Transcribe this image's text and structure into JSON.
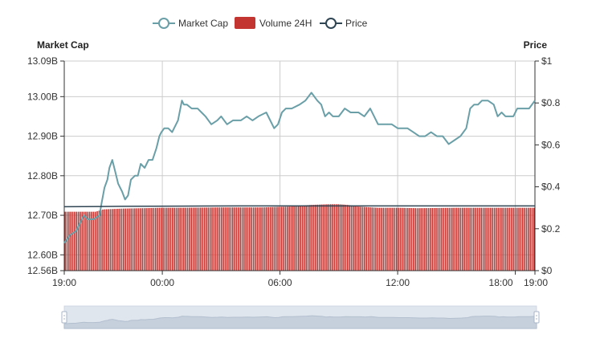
{
  "colors": {
    "market_cap": "#6a9fa8",
    "volume": "#c23531",
    "price": "#2f4554",
    "grid": "#cccccc",
    "zoom_fill": "#c7d0dd"
  },
  "legend": {
    "items": [
      {
        "name": "Market Cap",
        "icon": "line-circle-icon"
      },
      {
        "name": "Volume 24H",
        "icon": "rect-icon"
      },
      {
        "name": "Price",
        "icon": "line-circle-icon"
      }
    ]
  },
  "chart_data": {
    "type": "line",
    "title": "",
    "left_axis": {
      "title": "Market Cap",
      "min": 12.56,
      "max": 13.09,
      "unit": "B",
      "ticks": [
        "13.09B",
        "13.00B",
        "12.90B",
        "12.80B",
        "12.70B",
        "12.60B",
        "12.56B"
      ],
      "tick_values": [
        13.09,
        13.0,
        12.9,
        12.8,
        12.7,
        12.6,
        12.56
      ]
    },
    "right_axis": {
      "title": "Price",
      "min": 0,
      "max": 1,
      "ticks": [
        "$1",
        "$0.8",
        "$0.6",
        "$0.4",
        "$0.2",
        "$0"
      ],
      "tick_values": [
        1,
        0.8,
        0.6,
        0.4,
        0.2,
        0
      ]
    },
    "x_axis": {
      "min": 0,
      "max": 24,
      "ticks": [
        "19:00",
        "00:00",
        "06:00",
        "12:00",
        "18:00",
        "19:00"
      ],
      "tick_values": [
        0,
        5,
        11,
        17,
        23,
        24
      ]
    },
    "grid": true,
    "legend_position": "top-center",
    "series": [
      {
        "name": "Market Cap",
        "axis": "left",
        "x": [
          0,
          0.3,
          0.6,
          0.8,
          1.0,
          1.2,
          1.5,
          1.8,
          1.9,
          2.05,
          2.2,
          2.3,
          2.45,
          2.6,
          2.75,
          2.95,
          3.1,
          3.25,
          3.4,
          3.6,
          3.75,
          3.9,
          4.1,
          4.3,
          4.5,
          4.7,
          4.85,
          4.95,
          5.1,
          5.3,
          5.5,
          5.8,
          6.0,
          6.1,
          6.25,
          6.5,
          6.8,
          7.0,
          7.2,
          7.5,
          7.8,
          8.0,
          8.3,
          8.6,
          9.0,
          9.3,
          9.6,
          9.9,
          10.3,
          10.7,
          10.9,
          11.1,
          11.3,
          11.6,
          12.0,
          12.3,
          12.6,
          12.9,
          13.1,
          13.3,
          13.5,
          13.7,
          14.0,
          14.3,
          14.6,
          15.0,
          15.3,
          15.6,
          16.0,
          16.3,
          16.7,
          17.0,
          17.3,
          17.5,
          17.8,
          18.1,
          18.4,
          18.7,
          19.0,
          19.3,
          19.6,
          19.9,
          20.2,
          20.5,
          20.7,
          20.9,
          21.1,
          21.3,
          21.6,
          21.9,
          22.1,
          22.3,
          22.5,
          22.7,
          22.9,
          23.1,
          23.3,
          23.5,
          23.7,
          24.0
        ],
        "values": [
          12.63,
          12.65,
          12.66,
          12.68,
          12.7,
          12.69,
          12.69,
          12.7,
          12.73,
          12.77,
          12.79,
          12.82,
          12.84,
          12.81,
          12.78,
          12.76,
          12.74,
          12.75,
          12.79,
          12.8,
          12.8,
          12.83,
          12.82,
          12.84,
          12.84,
          12.87,
          12.9,
          12.91,
          12.92,
          12.92,
          12.91,
          12.94,
          12.99,
          12.98,
          12.98,
          12.97,
          12.97,
          12.96,
          12.95,
          12.93,
          12.94,
          12.95,
          12.93,
          12.94,
          12.94,
          12.95,
          12.94,
          12.95,
          12.96,
          12.92,
          12.93,
          12.96,
          12.97,
          12.97,
          12.98,
          12.99,
          13.01,
          12.99,
          12.98,
          12.95,
          12.96,
          12.95,
          12.95,
          12.97,
          12.96,
          12.96,
          12.95,
          12.97,
          12.93,
          12.93,
          12.93,
          12.92,
          12.92,
          12.92,
          12.91,
          12.9,
          12.9,
          12.91,
          12.9,
          12.9,
          12.88,
          12.89,
          12.9,
          12.92,
          12.97,
          12.98,
          12.98,
          12.99,
          12.99,
          12.98,
          12.95,
          12.96,
          12.95,
          12.95,
          12.95,
          12.97,
          12.97,
          12.97,
          12.97,
          12.99
        ]
      },
      {
        "name": "Volume 24H",
        "axis": "left",
        "type": "bar",
        "x_start": 0,
        "x_end": 24,
        "envelope_x": [
          0,
          1.6,
          2.0,
          3.0,
          5.0,
          6.0,
          8.0,
          10.0,
          11.5,
          12.5,
          13.5,
          14.0,
          14.5,
          15.0,
          16.0,
          17.0,
          18.0,
          20.0,
          22.0,
          24.0
        ],
        "envelope_values": [
          12.709,
          12.709,
          12.715,
          12.717,
          12.719,
          12.719,
          12.72,
          12.72,
          12.722,
          12.726,
          12.728,
          12.728,
          12.726,
          12.722,
          12.719,
          12.719,
          12.718,
          12.719,
          12.719,
          12.719
        ]
      },
      {
        "name": "Price",
        "axis": "right",
        "x": [
          0,
          3,
          6,
          9,
          12,
          15,
          18,
          21,
          24
        ],
        "values": [
          0.305,
          0.307,
          0.308,
          0.309,
          0.309,
          0.309,
          0.309,
          0.309,
          0.309
        ]
      }
    ],
    "data_zoom": {
      "start": 0,
      "end": 100
    }
  }
}
